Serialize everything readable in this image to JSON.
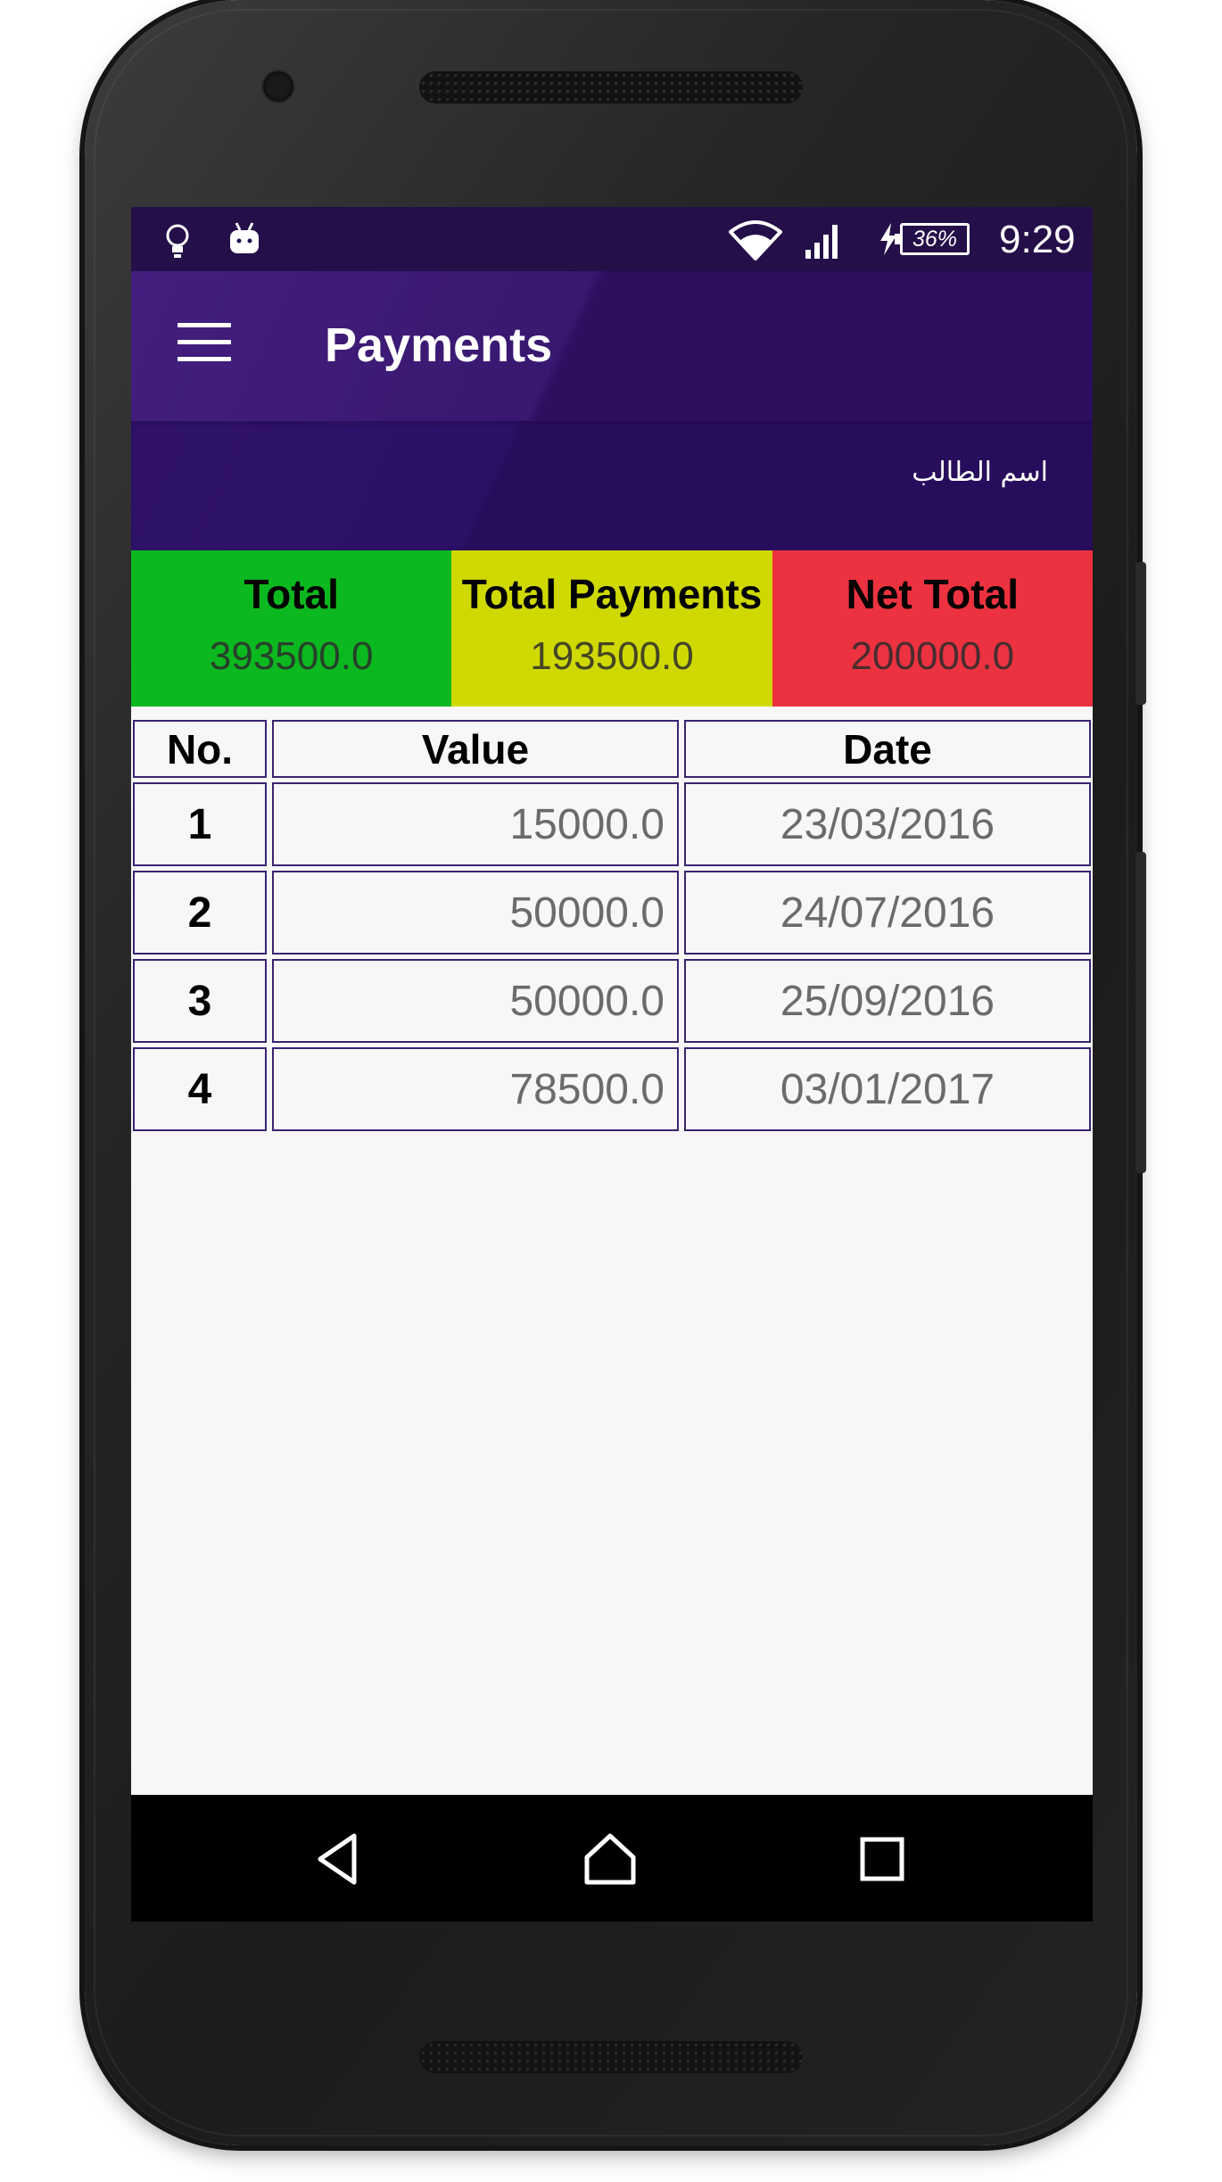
{
  "status_bar": {
    "battery": "36%",
    "time": "9:29",
    "icons": [
      "lightbulb-icon",
      "android-icon",
      "wifi-icon",
      "signal-icon",
      "charging-icon",
      "battery-icon"
    ]
  },
  "app_bar": {
    "title": "Payments",
    "menu_icon": "hamburger-icon"
  },
  "header": {
    "student_name_label": "اسم الطالب"
  },
  "summary": [
    {
      "label": "Total",
      "value": "393500.0",
      "color": "#0cb81f"
    },
    {
      "label": "Total Payments",
      "value": "193500.0",
      "color": "#cfd900"
    },
    {
      "label": "Net Total",
      "value": "200000.0",
      "color": "#ec3240"
    }
  ],
  "table": {
    "headers": {
      "no": "No.",
      "value": "Value",
      "date": "Date"
    },
    "rows": [
      {
        "no": "1",
        "value": "15000.0",
        "date": "23/03/2016"
      },
      {
        "no": "2",
        "value": "50000.0",
        "date": "24/07/2016"
      },
      {
        "no": "3",
        "value": "50000.0",
        "date": "25/09/2016"
      },
      {
        "no": "4",
        "value": "78500.0",
        "date": "03/01/2017"
      }
    ]
  },
  "nav_bar": {
    "icons": [
      "back-icon",
      "home-icon",
      "recents-icon"
    ]
  },
  "colors": {
    "status_bar": "#240f49",
    "app_bar": "#3a1872",
    "subheader": "#2a0e60",
    "table_border": "#3a2470"
  }
}
